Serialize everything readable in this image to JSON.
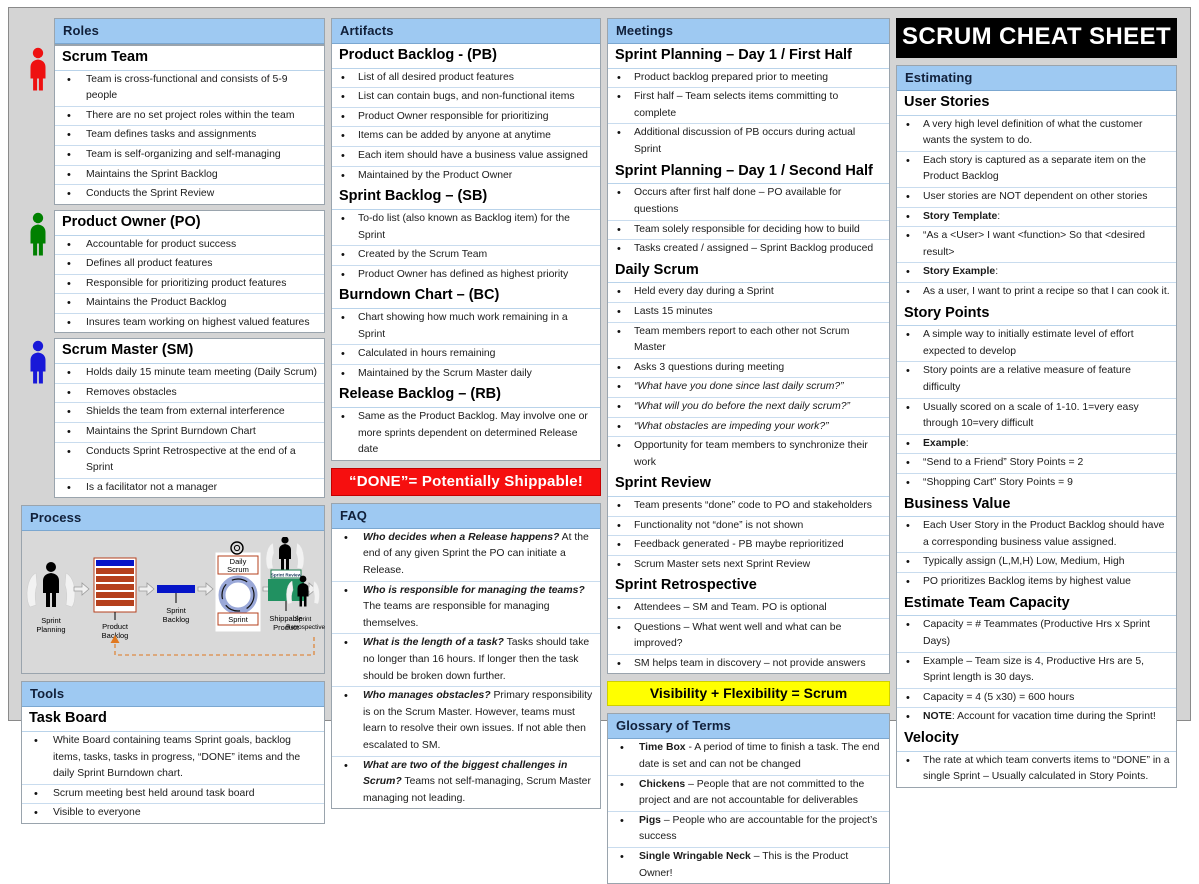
{
  "title": "SCRUM CHEAT SHEET",
  "column1": {
    "roles": {
      "header": "Roles",
      "groups": [
        {
          "icon": "person-icon-red",
          "color": "#ee1111",
          "title": "Scrum Team",
          "items": [
            "Team is cross-functional and consists of 5-9 people",
            "There are no set project roles within the team",
            "Team defines tasks and assignments",
            "Team is self-organizing and self-managing",
            "Maintains the Sprint Backlog",
            "Conducts the Sprint Review"
          ]
        },
        {
          "icon": "person-icon-green",
          "color": "#008000",
          "title": "Product Owner (PO)",
          "items": [
            "Accountable for product success",
            "Defines all product features",
            "Responsible for prioritizing product features",
            "Maintains the Product Backlog",
            "Insures team working on highest valued features"
          ]
        },
        {
          "icon": "person-icon-blue",
          "color": "#1818d8",
          "title": "Scrum Master (SM)",
          "items": [
            "Holds daily 15 minute  team meeting (Daily Scrum)",
            "Removes obstacles",
            "Shields the team from external interference",
            "Maintains the Sprint Burndown Chart",
            "Conducts Sprint Retrospective at the end of a Sprint",
            "Is a facilitator not a manager"
          ]
        }
      ]
    },
    "process": {
      "header": "Process",
      "steps": [
        "Sprint Planning",
        "Product Backlog",
        "Sprint Backlog",
        "Daily Scrum",
        "Sprint",
        "Sprint Review",
        "Shippable Product",
        "Sprint Retrospective"
      ]
    },
    "tools": {
      "header": "Tools",
      "sub_title": "Task Board",
      "items": [
        "White Board containing teams Sprint goals, backlog items, tasks, tasks in progress, “DONE” items and the daily Sprint Burndown chart.",
        "Scrum meeting best held around task board",
        "Visible to everyone"
      ]
    }
  },
  "column2": {
    "artifacts": {
      "header": "Artifacts",
      "groups": [
        {
          "title": "Product Backlog - (PB)",
          "items": [
            "List of all desired product features",
            "List can contain bugs, and non-functional items",
            "Product Owner responsible for prioritizing",
            "Items can be added by anyone at anytime",
            "Each item should have a business value assigned",
            "Maintained by the Product Owner"
          ]
        },
        {
          "title": "Sprint Backlog – (SB)",
          "items": [
            "To-do list (also known as Backlog item) for the Sprint",
            "Created by the Scrum Team",
            "Product Owner has defined as highest priority"
          ]
        },
        {
          "title": "Burndown Chart – (BC)",
          "items": [
            "Chart showing how much work remaining in a Sprint",
            "Calculated in hours remaining",
            "Maintained by the Scrum Master daily"
          ]
        },
        {
          "title": "Release Backlog – (RB)",
          "items": [
            "Same as the Product Backlog. May involve one or more sprints dependent on determined Release date"
          ]
        }
      ],
      "banner": "“DONE”= Potentially Shippable!"
    },
    "faq": {
      "header": "FAQ",
      "items": [
        {
          "q": "Who decides when a Release happens?",
          "a": "At the end of any given Sprint the PO can initiate a Release."
        },
        {
          "q": "Who is responsible for managing the teams?",
          "a": "The teams are responsible for managing themselves."
        },
        {
          "q": "What is the length of a task?",
          "a": "Tasks should take no longer than 16 hours. If longer then the task should be broken down further."
        },
        {
          "q": "Who manages obstacles?",
          "a": "Primary responsibility is on the Scrum Master.  However, teams must learn to resolve their own issues.  If not able then escalated to SM."
        },
        {
          "q": "What are two of the biggest challenges in Scrum?",
          "a": "Teams not self-managing, Scrum Master managing not leading."
        }
      ]
    }
  },
  "column3": {
    "meetings": {
      "header": "Meetings",
      "groups": [
        {
          "title": "Sprint Planning – Day 1 / First Half",
          "items": [
            "Product backlog prepared prior to meeting",
            "First half – Team selects items committing to complete",
            "Additional discussion of PB occurs during actual Sprint"
          ]
        },
        {
          "title": "Sprint Planning – Day 1 / Second Half",
          "items": [
            "Occurs after first half done – PO available for questions",
            "Team solely responsible for deciding how to build",
            "Tasks created / assigned – Sprint Backlog produced"
          ]
        },
        {
          "title": "Daily Scrum",
          "items": [
            "Held every day during a Sprint",
            "Lasts 15 minutes",
            "Team members report to each other not Scrum Master",
            "Asks 3 questions during meeting"
          ],
          "questions": [
            "“What have you done since last daily scrum?”",
            "“What will you do before the next daily scrum?”",
            "“What obstacles are impeding your work?”"
          ],
          "items_after": [
            "Opportunity for team members to synchronize their work"
          ]
        },
        {
          "title": "Sprint Review",
          "items": [
            "Team presents “done” code to PO and stakeholders",
            "Functionality not “done” is not shown",
            "Feedback generated -  PB maybe reprioritized",
            "Scrum Master sets next Sprint Review"
          ]
        },
        {
          "title": "Sprint Retrospective",
          "items": [
            "Attendees – SM and Team.  PO is optional",
            "Questions – What went well and what can be improved?",
            "SM helps team in discovery – not provide answers"
          ]
        }
      ],
      "banner": "Visibility + Flexibility = Scrum"
    },
    "glossary": {
      "header": "Glossary of Terms",
      "items": [
        {
          "term": "Time Box",
          "def": " -  A period of time to finish a task. The end date is set and can not be changed"
        },
        {
          "term": "Chickens",
          "def": " – People that are not committed to the project and are not accountable for deliverables"
        },
        {
          "term": "Pigs",
          "def": " – People who are accountable for the project’s success"
        },
        {
          "term": "Single Wringable Neck",
          "def": " – This is the Product Owner!"
        }
      ]
    }
  },
  "column4": {
    "estimating": {
      "header": "Estimating",
      "groups": [
        {
          "title": "User Stories",
          "items": [
            {
              "text": "A very high level definition of  what the customer wants the system to do."
            },
            {
              "text": "Each story is captured as a separate item on the Product Backlog"
            },
            {
              "text": "User stories are NOT dependent on other stories"
            },
            {
              "bold": "Story Template",
              "text": ":"
            },
            {
              "text": "“As a <User> I want <function> So that <desired result>"
            },
            {
              "bold": "Story Example",
              "text": ":"
            },
            {
              "text": "As a user, I want to print a recipe so that I can cook it."
            }
          ]
        },
        {
          "title": "Story Points",
          "items": [
            {
              "text": "A simple way to initially estimate level of effort expected to develop"
            },
            {
              "text": "Story points are a relative measure of feature difficulty"
            },
            {
              "text": "Usually scored on a scale of 1-10.  1=very easy through 10=very difficult"
            },
            {
              "bold": "Example",
              "text": ":"
            },
            {
              "text": "“Send to a Friend” Story Points = 2"
            },
            {
              "text": "“Shopping Cart” Story Points = 9"
            }
          ]
        },
        {
          "title": "Business Value",
          "items": [
            {
              "text": "Each User Story in the Product Backlog should have a corresponding business value assigned."
            },
            {
              "text": "Typically assign (L,M,H) Low, Medium, High"
            },
            {
              "text": "PO prioritizes Backlog items by highest value"
            }
          ]
        },
        {
          "title": "Estimate Team Capacity",
          "items": [
            {
              "text": "Capacity = # Teammates (Productive Hrs x Sprint Days)"
            },
            {
              "text": "Example – Team size is 4, Productive Hrs are 5, Sprint length is 30 days."
            },
            {
              "text": "Capacity = 4 (5 x30) = 600 hours"
            },
            {
              "bold": "NOTE",
              "text": ":  Account for vacation time during the Sprint!"
            }
          ]
        },
        {
          "title": "Velocity",
          "items": [
            {
              "text": "The rate at which team converts items to “DONE” in a single Sprint – Usually calculated in Story Points."
            }
          ]
        }
      ]
    }
  }
}
